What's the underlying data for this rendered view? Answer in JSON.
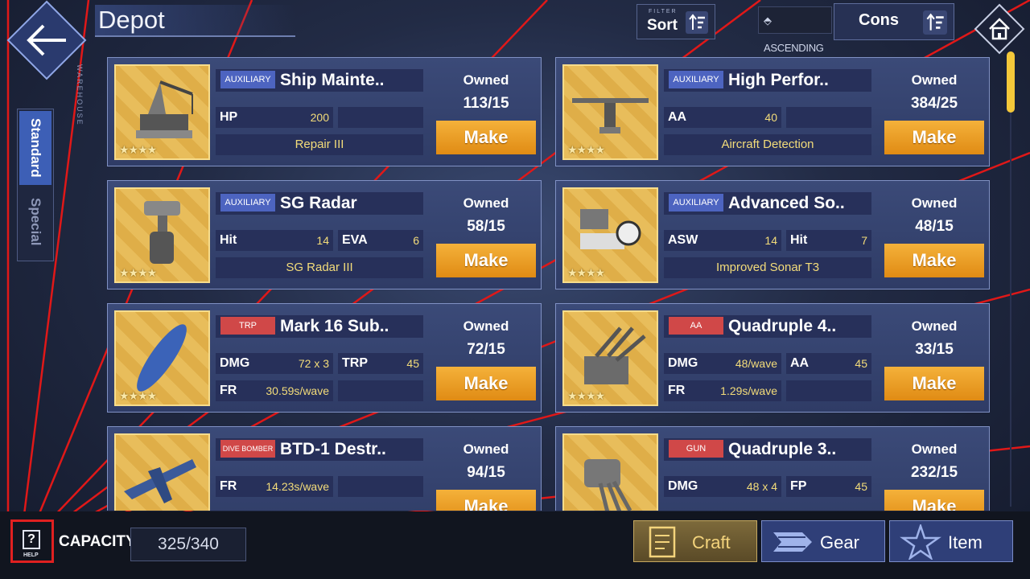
{
  "header": {
    "title": "Depot",
    "warehouse_label": "WAREHOUSE"
  },
  "sort": {
    "filter_label": "FILTER",
    "label": "Sort",
    "order": "ASCENDING",
    "cons_label": "Cons"
  },
  "tabs": [
    {
      "label": "Standard",
      "active": true
    },
    {
      "label": "Special",
      "active": false
    }
  ],
  "owned_label": "Owned",
  "make_label": "Make",
  "items": [
    {
      "type": "AUXILIARY",
      "type_color": "blue",
      "name": "Ship Mainte..",
      "stars": "★★★★",
      "stat1_key": "HP",
      "stat1_val": "200",
      "stat2_key": "",
      "stat2_val": "",
      "effect": "Repair III",
      "owned": "113/15"
    },
    {
      "type": "AUXILIARY",
      "type_color": "blue",
      "name": "High Perfor..",
      "stars": "★★★★",
      "stat1_key": "AA",
      "stat1_val": "40",
      "stat2_key": "",
      "stat2_val": "",
      "effect": "Aircraft Detection",
      "owned": "384/25"
    },
    {
      "type": "AUXILIARY",
      "type_color": "blue",
      "name": "SG Radar",
      "stars": "★★★★",
      "stat1_key": "Hit",
      "stat1_val": "14",
      "stat2_key": "EVA",
      "stat2_val": "6",
      "effect": "SG Radar III",
      "owned": "58/15"
    },
    {
      "type": "AUXILIARY",
      "type_color": "blue",
      "name": "Advanced So..",
      "stars": "★★★★",
      "stat1_key": "ASW",
      "stat1_val": "14",
      "stat2_key": "Hit",
      "stat2_val": "7",
      "effect": "Improved Sonar T3",
      "owned": "48/15"
    },
    {
      "type": "TRP",
      "type_color": "red",
      "name": "Mark 16 Sub..",
      "stars": "★★★★",
      "stat1_key": "DMG",
      "stat1_val": "72 x 3",
      "stat2_key": "TRP",
      "stat2_val": "45",
      "stat3_key": "FR",
      "stat3_val": "30.59s/wave",
      "owned": "72/15"
    },
    {
      "type": "AA",
      "type_color": "red",
      "name": "Quadruple 4..",
      "stars": "★★★★",
      "stat1_key": "DMG",
      "stat1_val": "48/wave",
      "stat2_key": "AA",
      "stat2_val": "45",
      "stat3_key": "FR",
      "stat3_val": "1.29s/wave",
      "owned": "33/15"
    },
    {
      "type": "DIVE BOMBER",
      "type_color": "red",
      "name": "BTD-1 Destr..",
      "stars": "★★★★",
      "stat1_key": "FR",
      "stat1_val": "14.23s/wave",
      "stat2_key": "",
      "stat2_val": "",
      "owned": "94/15"
    },
    {
      "type": "GUN",
      "type_color": "red",
      "name": "Quadruple 3..",
      "stars": "★★★★",
      "stat1_key": "DMG",
      "stat1_val": "48 x 4",
      "stat2_key": "FP",
      "stat2_val": "45",
      "owned": "232/15"
    }
  ],
  "footer": {
    "help_label": "HELP",
    "capacity_label": "CAPACITY",
    "capacity_value": "325/340",
    "nav": [
      {
        "label": "Craft",
        "active": true
      },
      {
        "label": "Gear",
        "active": false
      },
      {
        "label": "Item",
        "active": false
      }
    ]
  },
  "colors": {
    "accent": "#e08b14",
    "tab_active": "#3d5fb6",
    "stat_text": "#f3dc7a"
  }
}
